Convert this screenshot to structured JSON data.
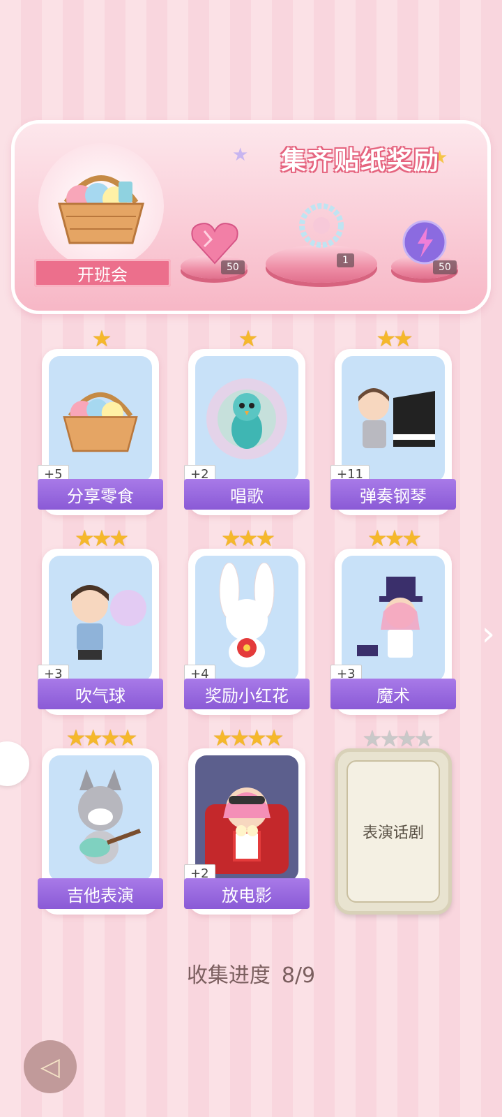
{
  "banner": {
    "title": "集齐贴纸奖励",
    "event_label": "开班会",
    "rewards": [
      {
        "icon": "pink-heart-gem-icon",
        "count": "50"
      },
      {
        "icon": "crystal-bracelet-icon",
        "count": "1"
      },
      {
        "icon": "purple-lightning-orb-icon",
        "count": "50"
      }
    ]
  },
  "cards": [
    {
      "label": "分享零食",
      "badge": "+5",
      "stars": 1,
      "image": "snack-basket-icon"
    },
    {
      "label": "唱歌",
      "badge": "+2",
      "stars": 1,
      "image": "singing-peacock-icon"
    },
    {
      "label": "弹奏钢琴",
      "badge": "+11",
      "stars": 2,
      "image": "piano-boy-icon"
    },
    {
      "label": "吹气球",
      "badge": "+3",
      "stars": 3,
      "image": "balloon-boy-icon"
    },
    {
      "label": "奖励小红花",
      "badge": "+4",
      "stars": 3,
      "image": "bunny-flower-icon"
    },
    {
      "label": "魔术",
      "badge": "+3",
      "stars": 3,
      "image": "magician-girl-icon"
    },
    {
      "label": "吉他表演",
      "badge": "",
      "stars": 4,
      "image": "guitar-wolf-icon"
    },
    {
      "label": "放电影",
      "badge": "+2",
      "stars": 4,
      "image": "movie-girl-icon"
    },
    {
      "label": "表演话剧",
      "badge": "",
      "stars": 4,
      "locked": true
    }
  ],
  "progress": {
    "label": "收集进度",
    "value": "8/9"
  }
}
